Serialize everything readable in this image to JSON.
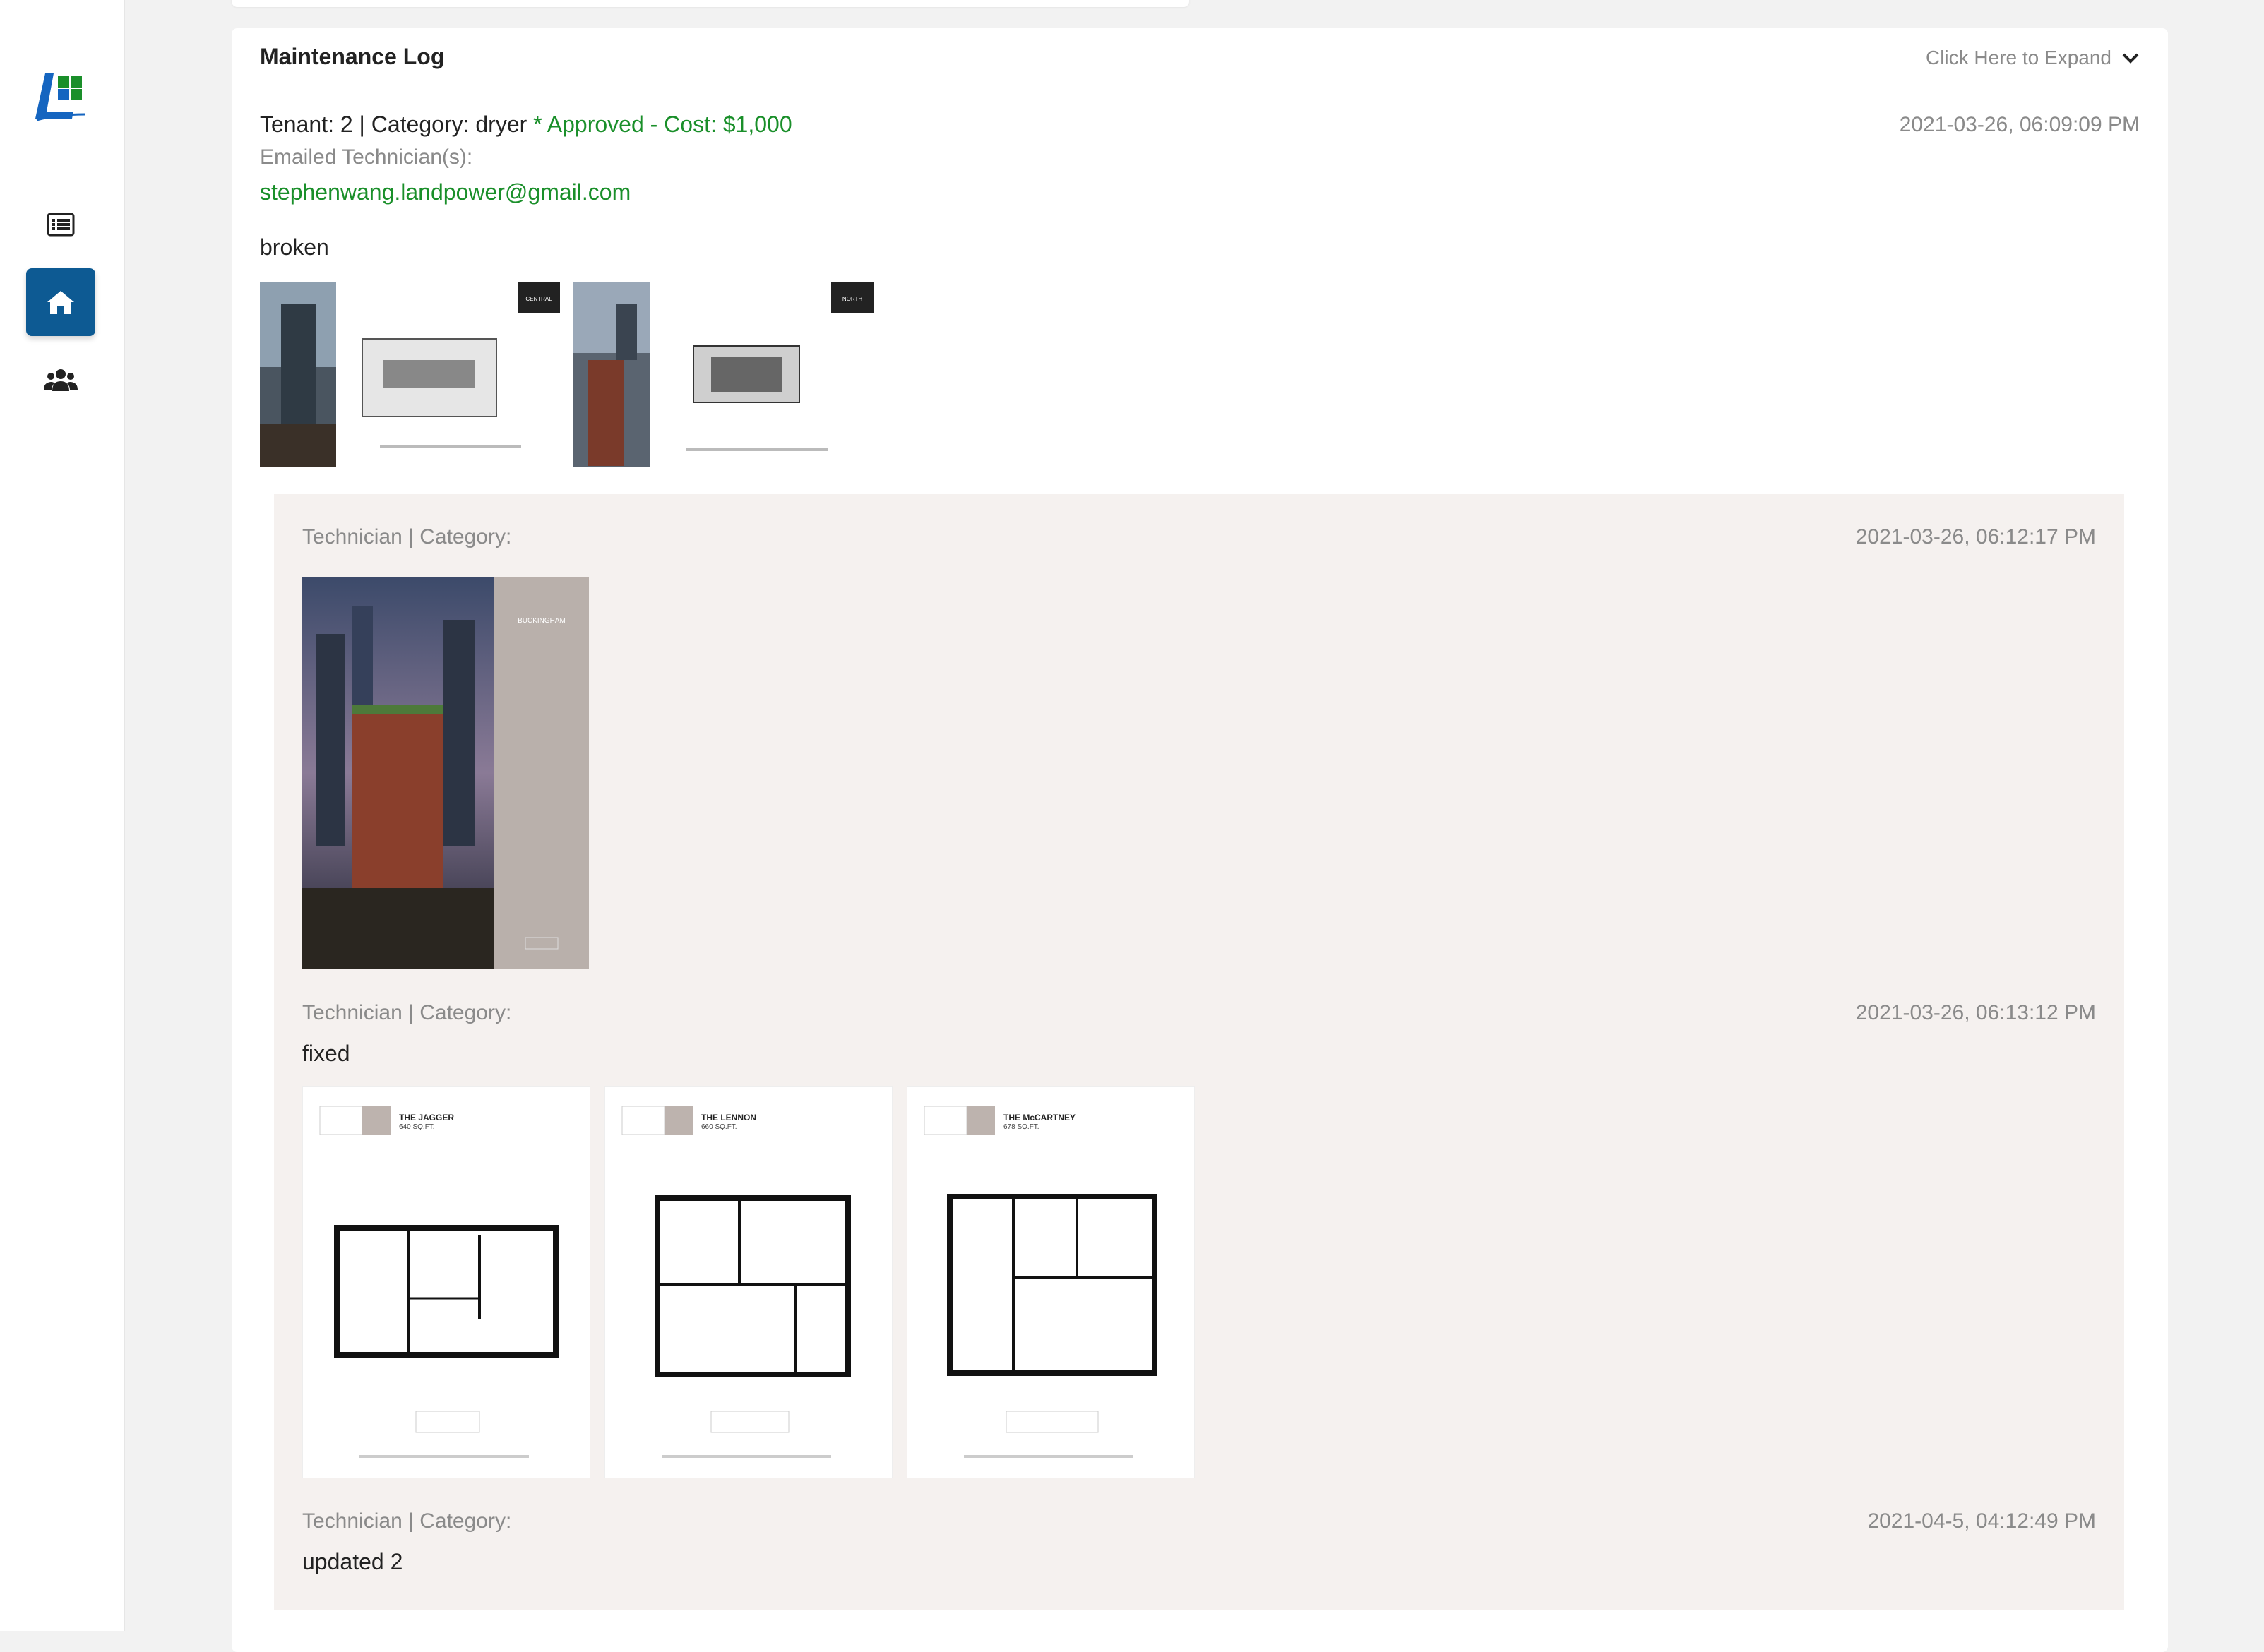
{
  "sidebar": {
    "logo": "LP",
    "items": [
      {
        "icon": "list-icon",
        "active": false
      },
      {
        "icon": "home-icon",
        "active": true
      },
      {
        "icon": "users-icon",
        "active": false
      }
    ],
    "accent": "#0d5a93"
  },
  "card": {
    "title": "Maintenance Log",
    "expand_label": "Click Here to Expand"
  },
  "entry": {
    "tenant_category": "Tenant: 2 | Category: dryer",
    "status": "* Approved - Cost: $1,000",
    "date": "2021-03-26, 06:09:09 PM",
    "emailed_label": "Emailed Technician(s):",
    "email": "stephenwang.landpower@gmail.com",
    "description": "broken",
    "thumb_labels": [
      "CENTRAL",
      "NORTH"
    ]
  },
  "replies": [
    {
      "header": "Technician | Category:",
      "date": "2021-03-26, 06:12:17 PM",
      "text": "",
      "image_label": "BUCKINGHAM"
    },
    {
      "header": "Technician | Category:",
      "date": "2021-03-26, 06:13:12 PM",
      "text": "fixed",
      "plans": [
        {
          "name": "THE JAGGER",
          "size": "640 SQ.FT."
        },
        {
          "name": "THE LENNON",
          "size": "660 SQ.FT."
        },
        {
          "name": "THE McCARTNEY",
          "size": "678 SQ.FT."
        }
      ]
    },
    {
      "header": "Technician | Category:",
      "date": "2021-04-5, 04:12:49 PM",
      "text": "updated 2"
    }
  ],
  "colors": {
    "green": "#1a8f2a",
    "muted": "#8a8a8a",
    "reply_bg": "#f5f1ef"
  }
}
